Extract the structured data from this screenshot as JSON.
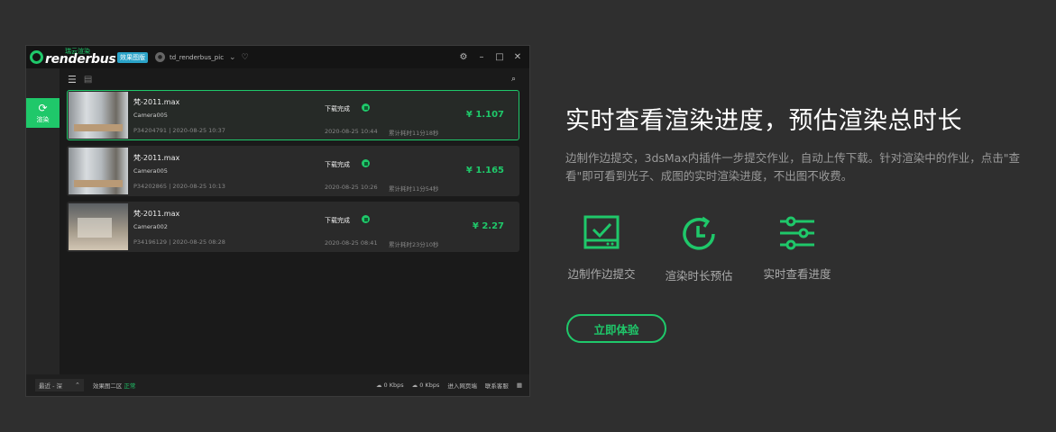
{
  "app": {
    "logo_cn": "瑞云渲染",
    "logo_en": "renderbus",
    "badge": "效果图版",
    "username": "td_renderbus_pic",
    "sidebar": {
      "label": "渲染"
    },
    "jobs": [
      {
        "name": "梵-2011.max",
        "camera": "Camera005",
        "meta": "P34204791 | 2020-08-25 10:37",
        "status": "下载完成",
        "date": "2020-08-25 10:44",
        "duration": "累计耗时11分18秒",
        "price": "¥ 1.107",
        "selected": true
      },
      {
        "name": "梵-2011.max",
        "camera": "Camera005",
        "meta": "P34202865 | 2020-08-25 10:13",
        "status": "下载完成",
        "date": "2020-08-25 10:26",
        "duration": "累计耗时11分54秒",
        "price": "¥ 1.165",
        "selected": false
      },
      {
        "name": "梵-2011.max",
        "camera": "Camera002",
        "meta": "P34196129 | 2020-08-25 08:28",
        "status": "下载完成",
        "date": "2020-08-25 08:41",
        "duration": "累计耗时23分10秒",
        "price": "¥ 2.27",
        "selected": false
      }
    ],
    "statusbar": {
      "region": "最近 - 深",
      "quality_label": "效果图二区",
      "quality_status": "正常",
      "upload": "0 Kbps",
      "download": "0 Kbps",
      "web_link": "进入网页端",
      "contact": "联系客服"
    }
  },
  "marketing": {
    "headline": "实时查看渲染进度，预估渲染总时长",
    "description": "边制作边提交，3dsMax内插件一步提交作业，自动上传下载。针对渲染中的作业，点击\"查看\"即可看到光子、成图的实时渲染进度，不出图不收费。",
    "features": [
      {
        "icon": "monitor-check-icon",
        "label": "边制作边提交"
      },
      {
        "icon": "clock-refresh-icon",
        "label": "渲染时长预估"
      },
      {
        "icon": "sliders-icon",
        "label": "实时查看进度"
      }
    ],
    "cta": "立即体验",
    "accent": "#1fc86a"
  }
}
